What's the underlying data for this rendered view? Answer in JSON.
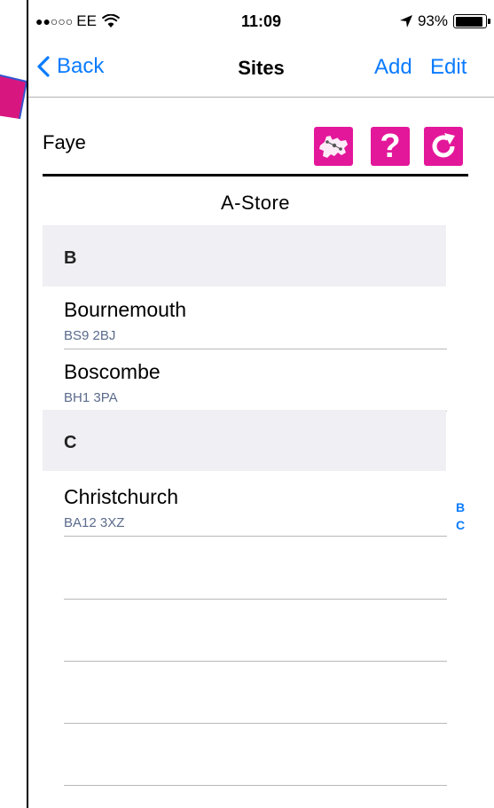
{
  "status_bar": {
    "signal": "●●○○○",
    "carrier": "EE",
    "time": "11:09",
    "battery_percent": "93%",
    "battery_level": 0.93,
    "icons": [
      "wifi-icon",
      "location-arrow-icon",
      "battery-icon"
    ]
  },
  "nav": {
    "back_label": "Back",
    "title": "Sites",
    "add_label": "Add",
    "edit_label": "Edit",
    "tint_color": "#0a7bff"
  },
  "header": {
    "user_name": "Faye",
    "buttons": [
      {
        "icon": "map-icon"
      },
      {
        "label": "?",
        "icon": "help-icon"
      },
      {
        "icon": "refresh-icon"
      }
    ],
    "button_color": "#e3179a"
  },
  "store_name": "A-Store",
  "sections": [
    {
      "letter": "B",
      "sites": [
        {
          "name": "Bournemouth",
          "postcode": "BS9 2BJ"
        },
        {
          "name": "Boscombe",
          "postcode": "BH1 3PA"
        }
      ]
    },
    {
      "letter": "C",
      "sites": [
        {
          "name": "Christchurch",
          "postcode": "BA12 3XZ"
        }
      ]
    }
  ],
  "index": [
    "B",
    "C"
  ]
}
